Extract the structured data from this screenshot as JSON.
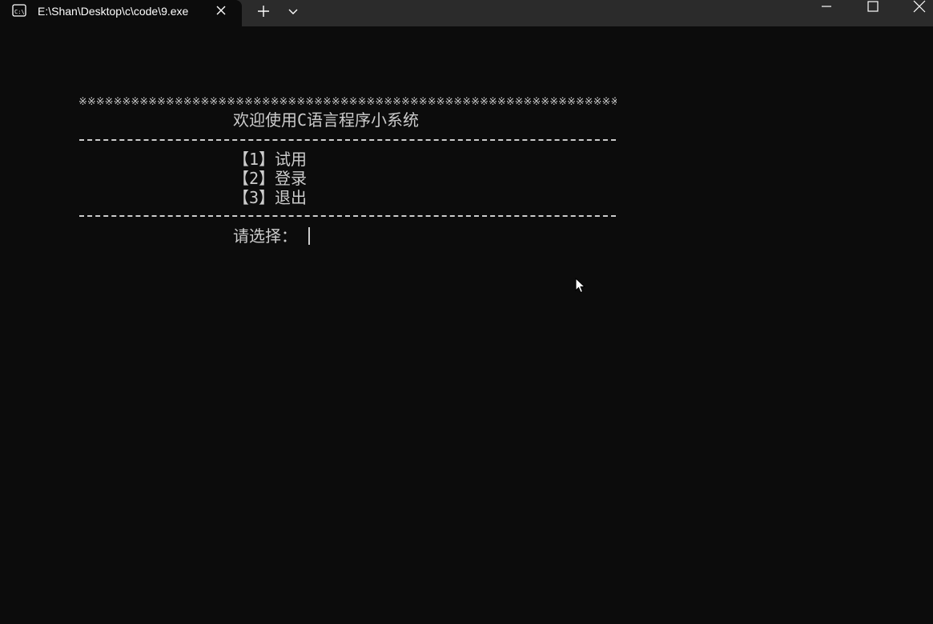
{
  "tab": {
    "title": "E:\\Shan\\Desktop\\c\\code\\9.exe",
    "icon": "terminal-icon"
  },
  "colors": {
    "background": "#0c0c0c",
    "titlebar": "#2b2b2b",
    "text": "#cccccc"
  },
  "console": {
    "border_stars": "※※※※※※※※※※※※※※※※※※※※※※※※※※※※※※※※※※※※※※※※※※※※※※※※※※※※※※※※※※※※※※※※※※※※※※※※※※※※※※※※※※※※※",
    "title": "欢迎使用C语言程序小系统",
    "menu": [
      "【1】试用",
      "【2】登录",
      "【3】退出"
    ],
    "prompt": "请选择："
  }
}
